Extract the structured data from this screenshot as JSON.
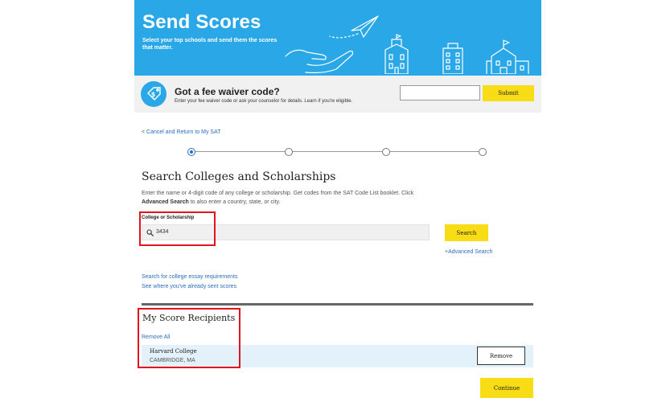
{
  "hero": {
    "title": "Send Scores",
    "subtitle": "Select your top schools and send them the scores that matter."
  },
  "fee_waiver": {
    "icon": "tag-dollar-icon",
    "title": "Got a fee waiver code?",
    "description": "Enter your fee waiver code or ask your counselor for details. Learn if you're eligible.",
    "input_value": "",
    "submit_label": "Submit"
  },
  "nav": {
    "back_link": "< Cancel and Return to My SAT"
  },
  "progress": {
    "total_steps": 4,
    "current_step": 1
  },
  "search": {
    "heading": "Search Colleges and Scholarships",
    "description_part1": "Enter the name or 4-digit code of any college or scholarship. Get codes from the SAT Code List booklet. Click ",
    "description_bold": "Advanced Search",
    "description_part2": " to also enter a country, state, or city.",
    "field_label": "College or Scholarship",
    "field_value": "3434",
    "search_label": "Search",
    "advanced_link": "+Advanced Search"
  },
  "links": {
    "essay": "Search for college essay requirements",
    "sent": "See where you've already sent scores"
  },
  "recipients": {
    "heading": "My Score Recipients",
    "remove_all": "Remove All",
    "items": [
      {
        "name": "Harvard College",
        "location": "CAMBRIDGE, MA",
        "remove_label": "Remove"
      }
    ]
  },
  "continue_label": "Continue",
  "colors": {
    "brand_blue": "#2aa7e6",
    "button_yellow": "#f7dc16",
    "link_blue": "#2a6ebf",
    "highlight_red": "#e0131f",
    "row_highlight": "#e3f1fa"
  }
}
